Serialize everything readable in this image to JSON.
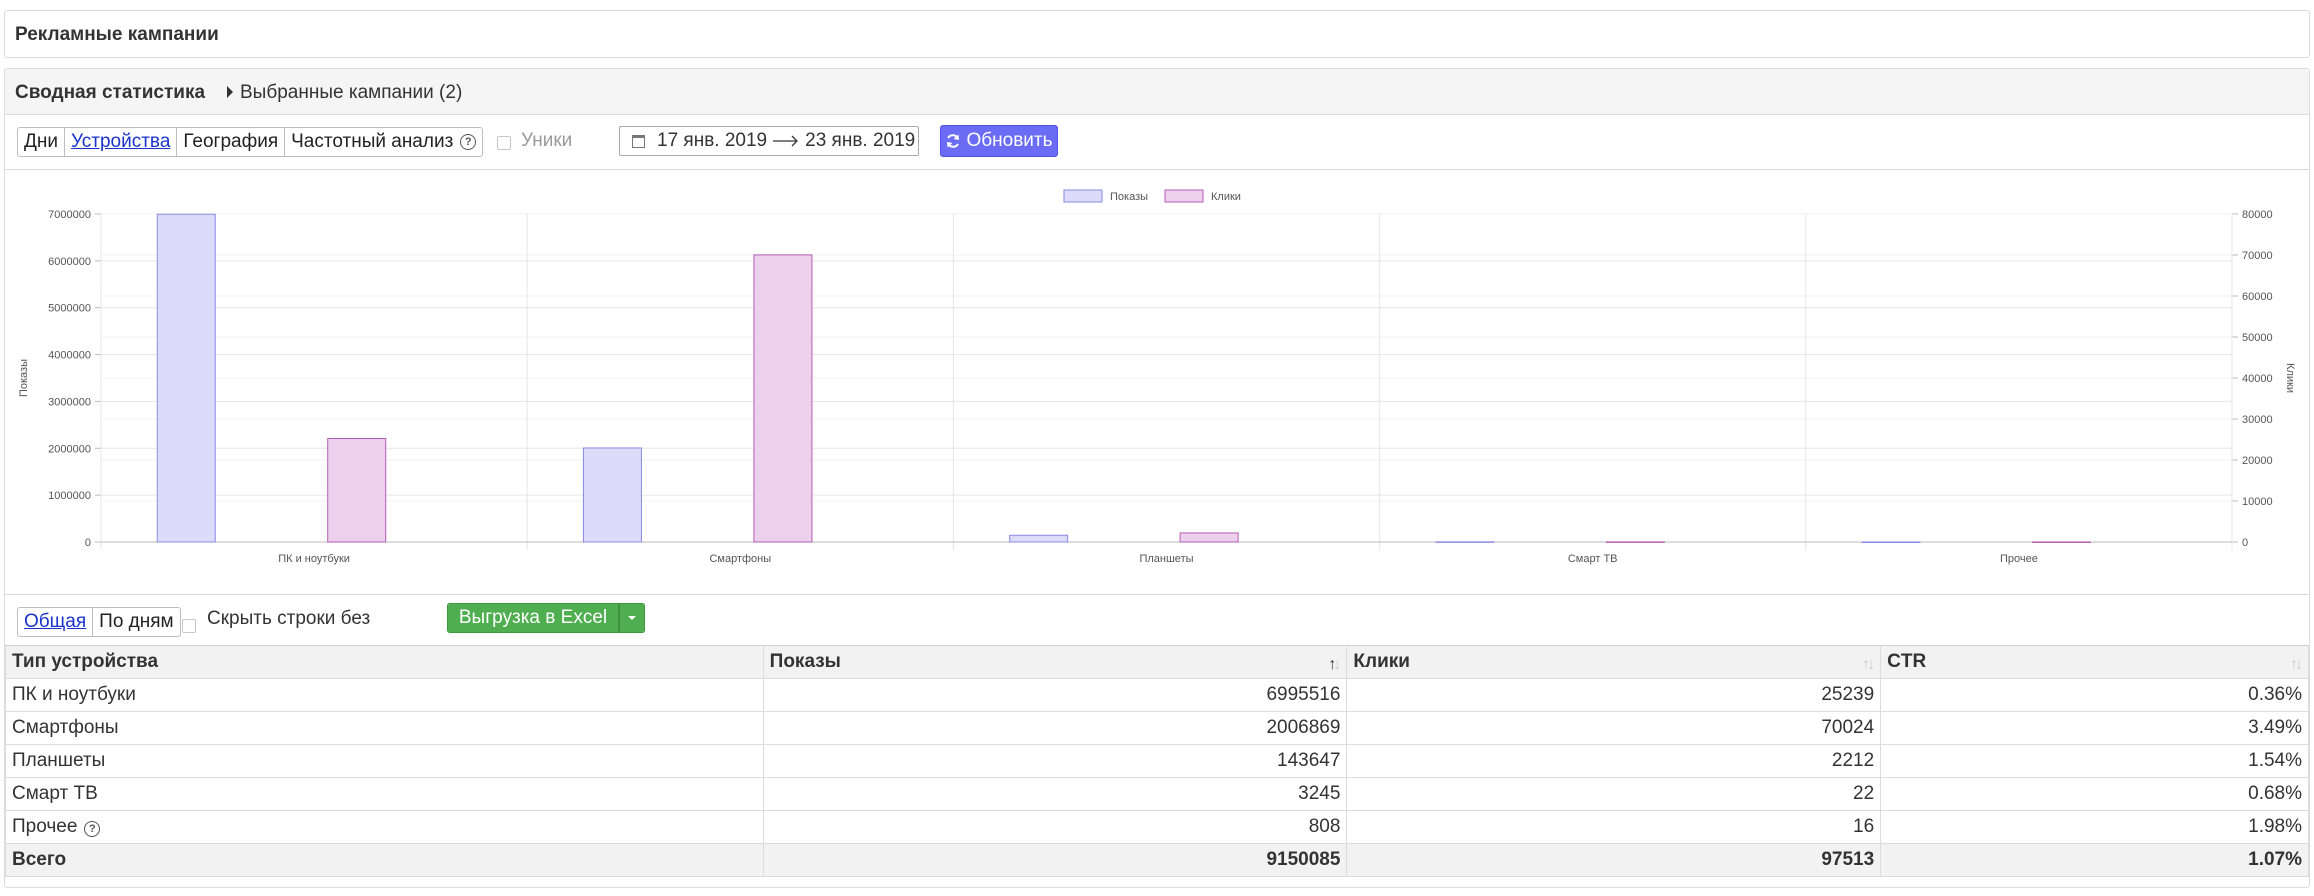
{
  "page": {
    "title": "Рекламные кампании"
  },
  "stats": {
    "title": "Сводная статистика",
    "selected_campaigns": "Выбранные кампании (2)"
  },
  "toolbar": {
    "tabs": [
      {
        "label": "Дни",
        "active": false
      },
      {
        "label": "Устройства",
        "active": true
      },
      {
        "label": "География",
        "active": false
      },
      {
        "label": "Частотный анализ",
        "active": false,
        "icon": "help-circle-icon"
      }
    ],
    "uniques_label": "Уники",
    "uniques_checked": false,
    "date_from": "17 янв. 2019",
    "date_to": "23 янв. 2019",
    "refresh_label": "Обновить",
    "accent_color": "#6a6cf5"
  },
  "chart_data": {
    "type": "bar",
    "categories": [
      "ПК и ноутбуки",
      "Смартфоны",
      "Планшеты",
      "Смарт ТВ",
      "Прочее"
    ],
    "series": [
      {
        "name": "Показы",
        "axis": "left",
        "values": [
          6995516,
          2006869,
          143647,
          3245,
          808
        ],
        "fill": "#dcdcfa",
        "stroke": "#8a8ae6"
      },
      {
        "name": "Клики",
        "axis": "right",
        "values": [
          25239,
          70024,
          2212,
          22,
          16
        ],
        "fill": "#ecd0ec",
        "stroke": "#b45cb4"
      }
    ],
    "ylabel": "Показы",
    "y2label": "Клики",
    "ylim": [
      0,
      7000000
    ],
    "y2lim": [
      0,
      80000
    ],
    "yticks": [
      "0",
      "1000000",
      "2000000",
      "3000000",
      "4000000",
      "5000000",
      "6000000",
      "7000000"
    ],
    "y2ticks": [
      "0",
      "10000",
      "20000",
      "30000",
      "40000",
      "50000",
      "60000",
      "70000",
      "80000"
    ],
    "legend_position": "top-center",
    "grid": true
  },
  "table_toolbar": {
    "tabs": [
      {
        "label": "Общая",
        "active": true
      },
      {
        "label": "По дням",
        "active": false
      }
    ],
    "hide_empty_label": "Скрыть строки без статистики",
    "hide_empty_checked": false,
    "export_label": "Выгрузка в Excel",
    "export_color": "#4fae4f"
  },
  "table": {
    "headers": [
      "Тип устройства",
      "Показы",
      "Клики",
      "CTR"
    ],
    "rows": [
      [
        "ПК и ноутбуки",
        "6995516",
        "25239",
        "0.36%"
      ],
      [
        "Смартфоны",
        "2006869",
        "70024",
        "3.49%"
      ],
      [
        "Планшеты",
        "143647",
        "2212",
        "1.54%"
      ],
      [
        "Смарт ТВ",
        "3245",
        "22",
        "0.68%"
      ],
      [
        "Прочее",
        "808",
        "16",
        "1.98%"
      ]
    ],
    "total": [
      "Всего",
      "9150085",
      "97513",
      "1.07%"
    ]
  }
}
